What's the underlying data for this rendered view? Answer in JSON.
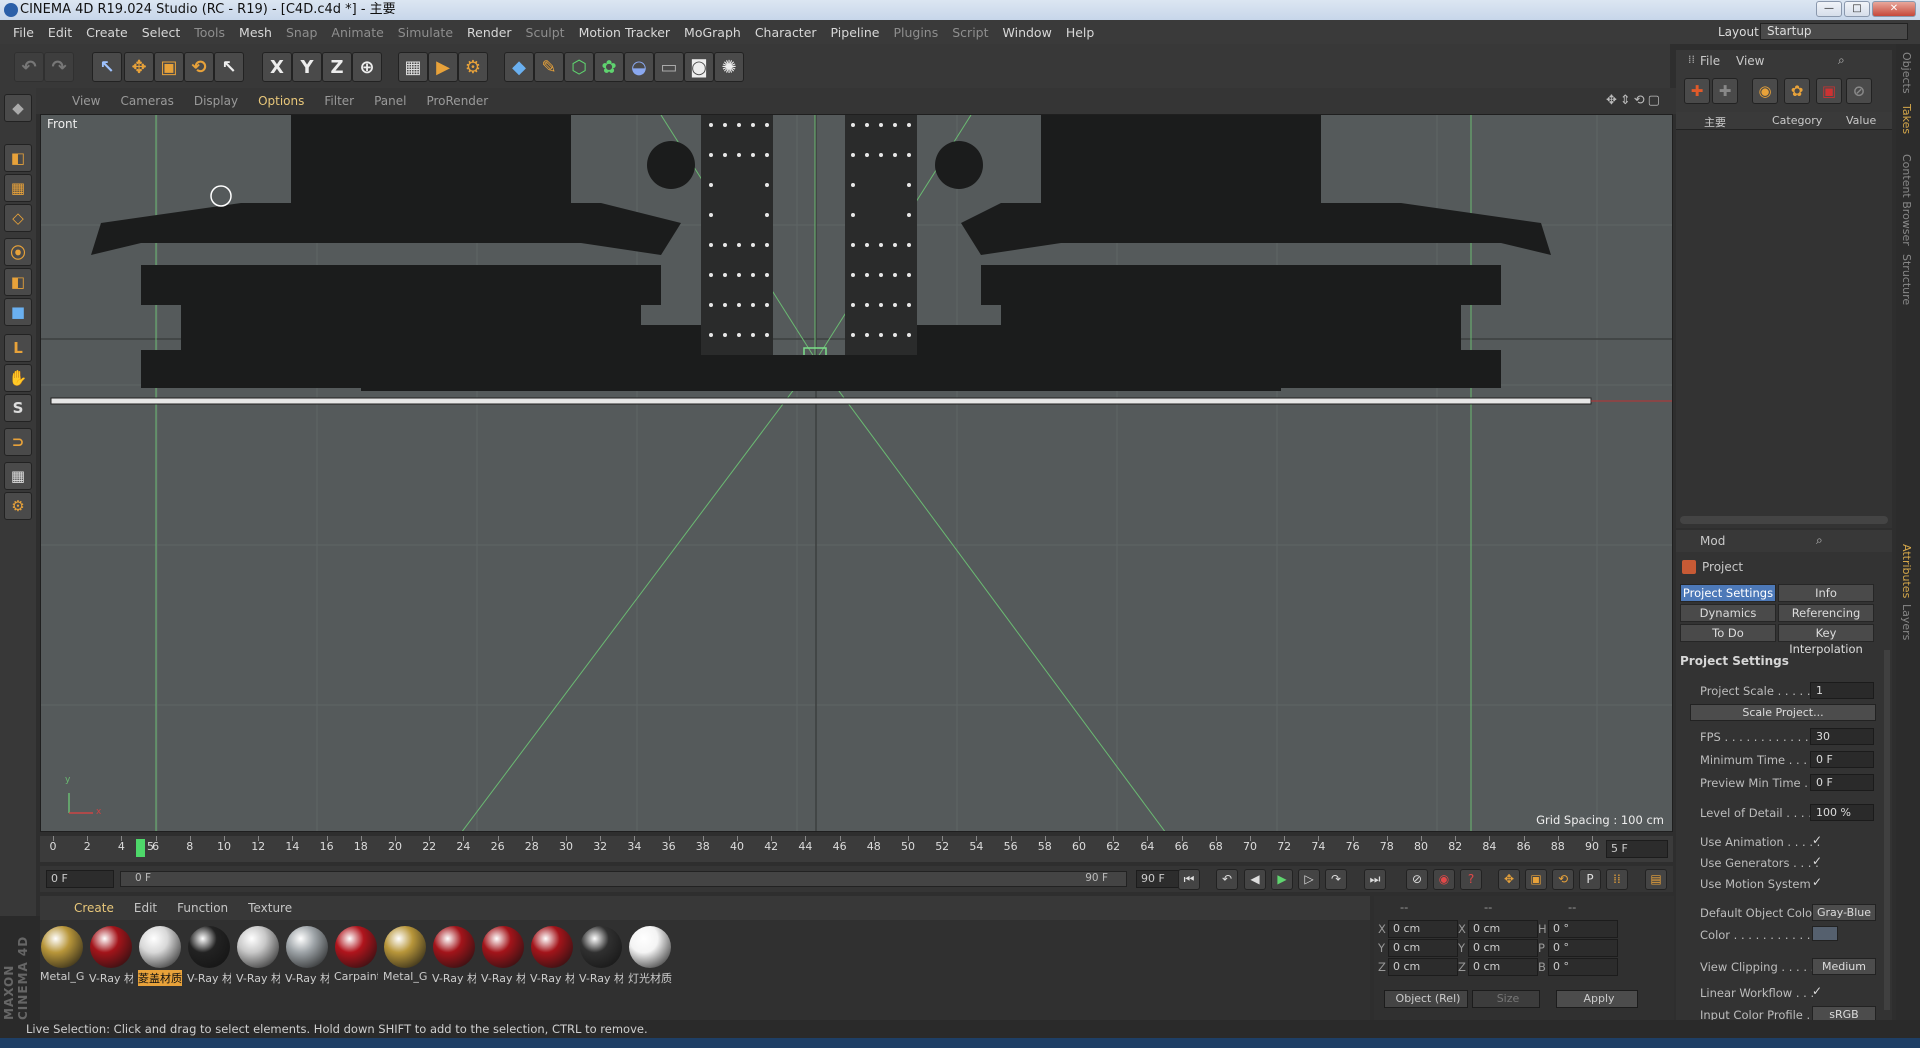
{
  "window": {
    "title": "CINEMA 4D R19.024 Studio (RC - R19) - [C4D.c4d *] - 主要",
    "controls": [
      "—",
      "□",
      "✕"
    ]
  },
  "menubar": {
    "items": [
      "File",
      "Edit",
      "Create",
      "Select",
      "Tools",
      "Mesh",
      "Snap",
      "Animate",
      "Simulate",
      "Render",
      "Sculpt",
      "Motion Tracker",
      "MoGraph",
      "Character",
      "Pipeline",
      "Plugins",
      "Script",
      "Window",
      "Help"
    ],
    "layout_label": "Layout:",
    "layout_value": "Startup"
  },
  "toolbar": {
    "icons": [
      "undo-icon",
      "redo-icon",
      "live-selection-icon",
      "move-icon",
      "scale-icon",
      "rotate-icon",
      "recent-tool-icon",
      "x-axis-icon",
      "y-axis-icon",
      "z-axis-icon",
      "world-coord-icon",
      "render-view-icon",
      "render-picture-viewer-icon",
      "edit-render-settings-icon",
      "cube-icon",
      "pen-icon",
      "subdivision-icon",
      "cloner-icon",
      "deformer-icon",
      "floor-icon",
      "camera-icon",
      "light-icon"
    ],
    "axis_labels": [
      "X",
      "Y",
      "Z"
    ]
  },
  "left_tools": {
    "icons": [
      "make-editable-icon",
      "model-mode-icon",
      "texture-mode-icon",
      "workplane-icon",
      "points-mode-icon",
      "edges-mode-icon",
      "polygons-mode-icon",
      "axis-mode-icon",
      "tweak-icon",
      "solo-icon",
      "magnet-icon",
      "snap-icon",
      "workplane-lock-icon"
    ]
  },
  "viewport": {
    "menu": [
      "View",
      "Cameras",
      "Display",
      "Options",
      "Filter",
      "Panel",
      "ProRender"
    ],
    "active_menu": "Options",
    "label": "Front",
    "grid_spacing": "Grid Spacing : 100 cm",
    "axis_y": "y",
    "axis_x": "x"
  },
  "timeline": {
    "ticks": [
      "0",
      "2",
      "4",
      "6",
      "8",
      "10",
      "12",
      "14",
      "16",
      "18",
      "20",
      "22",
      "24",
      "26",
      "28",
      "30",
      "32",
      "34",
      "36",
      "38",
      "40",
      "42",
      "44",
      "46",
      "48",
      "50",
      "52",
      "54",
      "56",
      "58",
      "60",
      "62",
      "64",
      "66",
      "68",
      "70",
      "72",
      "74",
      "76",
      "78",
      "80",
      "82",
      "84",
      "86",
      "88",
      "90"
    ],
    "current_frame_marker": "5",
    "current_frame_field": "5 F"
  },
  "playback": {
    "start": "0 F",
    "range_start": "0 F",
    "range_end": "90 F",
    "end": "90 F"
  },
  "material_manager": {
    "menu": [
      "Create",
      "Edit",
      "Function",
      "Texture"
    ],
    "materials": [
      {
        "label": "Metal_G",
        "color": "#b8963a"
      },
      {
        "label": "V-Ray 材",
        "color": "#a3141a"
      },
      {
        "label": "菱盖材质",
        "color": "#d8d8d8",
        "selected": true
      },
      {
        "label": "V-Ray 材",
        "color": "#222222"
      },
      {
        "label": "V-Ray 材",
        "color": "#c8c8c8"
      },
      {
        "label": "V-Ray 材",
        "color": "#9ea4a8"
      },
      {
        "label": "Carpaint",
        "color": "#b0141c"
      },
      {
        "label": "Metal_G",
        "color": "#b8963a"
      },
      {
        "label": "V-Ray 材",
        "color": "#a3141a"
      },
      {
        "label": "V-Ray 材",
        "color": "#a3141a"
      },
      {
        "label": "V-Ray 材",
        "color": "#a3141a"
      },
      {
        "label": "V-Ray 材",
        "color": "#303030"
      },
      {
        "label": "灯光材质",
        "color": "#f4f4f4"
      }
    ]
  },
  "coordinates": {
    "headers": [
      "--",
      "--",
      "--"
    ],
    "rows": [
      {
        "a": "X",
        "av": "0 cm",
        "b": "X",
        "bv": "0 cm",
        "c": "H",
        "cv": "0 °"
      },
      {
        "a": "Y",
        "av": "0 cm",
        "b": "Y",
        "bv": "0 cm",
        "c": "P",
        "cv": "0 °"
      },
      {
        "a": "Z",
        "av": "0 cm",
        "b": "Z",
        "bv": "0 cm",
        "c": "B",
        "cv": "0 °"
      }
    ],
    "mode": "Object (Rel)",
    "size": "Size",
    "apply": "Apply"
  },
  "object_manager": {
    "menu": [
      "File",
      "View"
    ],
    "columns": [
      "主要",
      "Category",
      "Value"
    ]
  },
  "attributes": {
    "mode": "Mod",
    "title": "Project",
    "tabs": [
      "Project Settings",
      "Info",
      "Dynamics",
      "Referencing",
      "To Do",
      "Key Interpolation"
    ],
    "section": "Project Settings",
    "rows": [
      {
        "label": "Project Scale . . . . . .",
        "value": "1",
        "kind": "field"
      },
      {
        "label": "",
        "value": "Scale Project...",
        "kind": "wide"
      },
      {
        "label": "FPS . . . . . . . . . . . . .",
        "value": "30",
        "kind": "field"
      },
      {
        "label": "Minimum Time . . . .",
        "value": "0 F",
        "kind": "field"
      },
      {
        "label": "Preview Min Time . .",
        "value": "0 F",
        "kind": "field"
      },
      {
        "label": "Level of Detail . . . . .",
        "value": "100 %",
        "kind": "field"
      },
      {
        "label": "Use Animation . . . . .",
        "value": "✓",
        "kind": "check"
      },
      {
        "label": "Use Generators . . . .",
        "value": "✓",
        "kind": "check"
      },
      {
        "label": "Use Motion System",
        "value": "✓",
        "kind": "check"
      },
      {
        "label": "Default Object Color",
        "value": "Gray-Blue",
        "kind": "button"
      },
      {
        "label": "Color . . . . . . . . . . .",
        "value": "",
        "kind": "color"
      },
      {
        "label": "View Clipping . . . . .",
        "value": "Medium",
        "kind": "button"
      },
      {
        "label": "Linear Workflow . . .",
        "value": "✓",
        "kind": "check"
      },
      {
        "label": "Input Color Profile . .",
        "value": "sRGB",
        "kind": "button"
      }
    ]
  },
  "right_tabs": [
    "Objects",
    "Takes",
    "Content Browser",
    "Structure",
    "Attributes",
    "Layers"
  ],
  "status": "Live Selection: Click and drag to select elements. Hold down SHIFT to add to the selection, CTRL to remove.",
  "brand": "MAXON CINEMA 4D"
}
